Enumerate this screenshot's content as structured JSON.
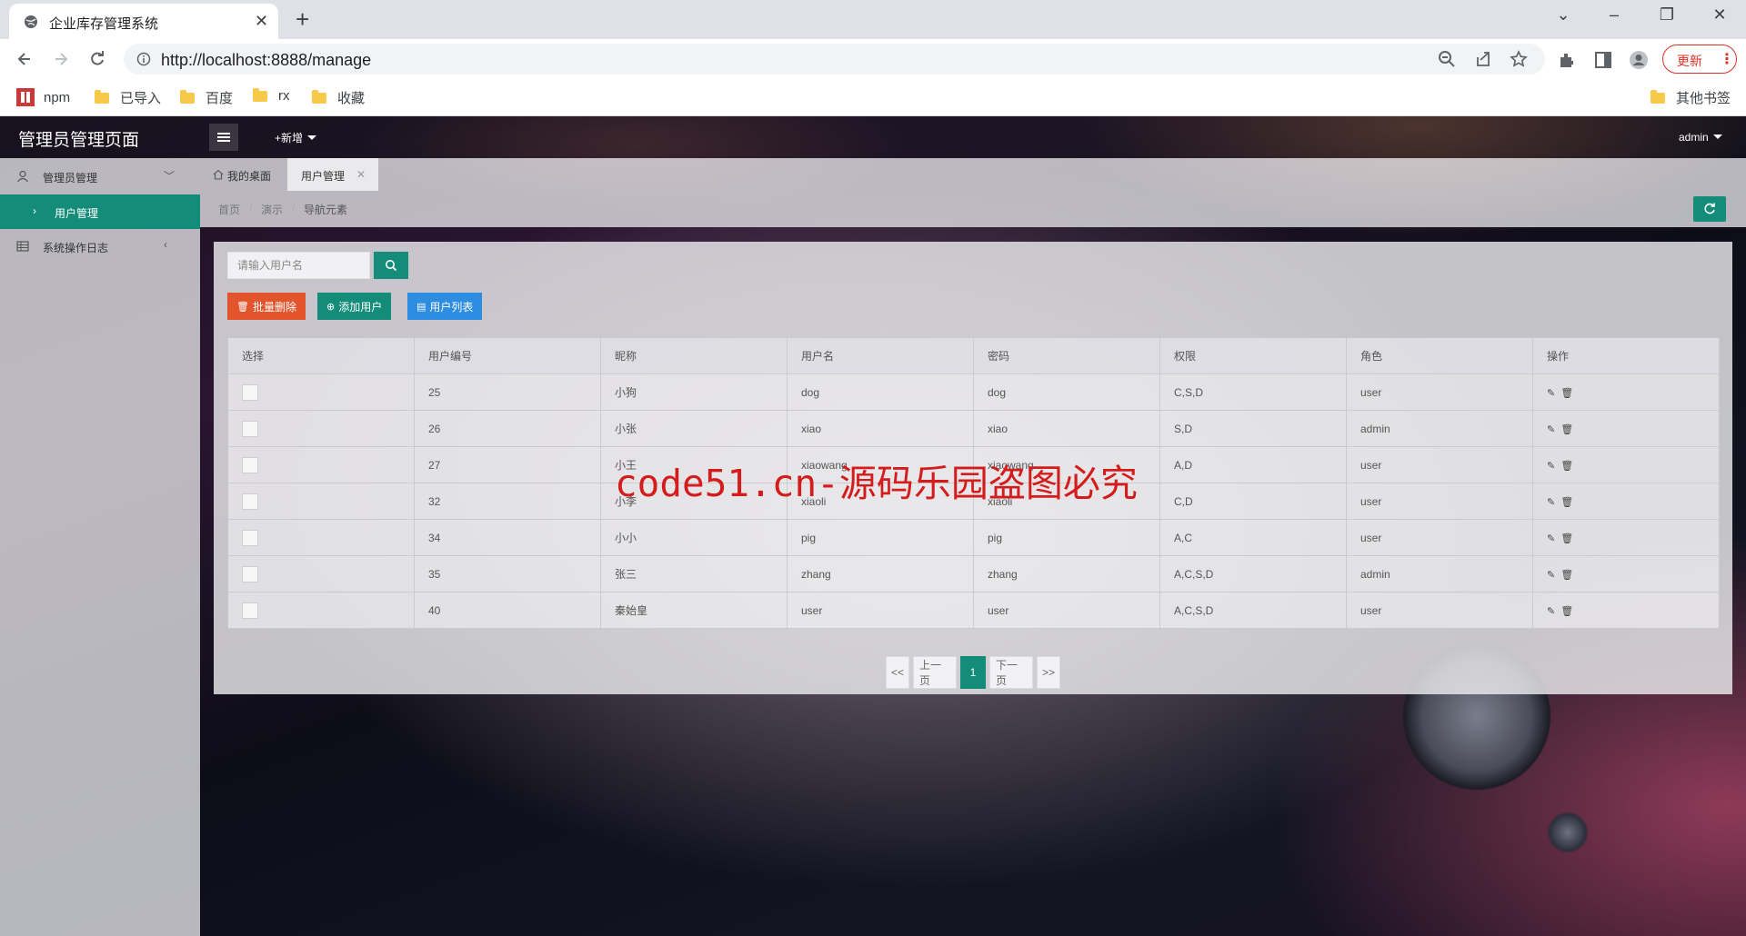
{
  "browser": {
    "tab_title": "企业库存管理系统",
    "url": "http://localhost:8888/manage",
    "update_label": "更新",
    "bookmarks": [
      "npm",
      "已导入",
      "百度",
      "rx",
      "收藏"
    ],
    "other_bookmarks": "其他书签"
  },
  "header": {
    "title": "管理员管理页面",
    "new_label": "+新增",
    "user_label": "admin"
  },
  "sidebar": {
    "items": [
      {
        "label": "管理员管理",
        "icon": "user-icon"
      },
      {
        "label": "用户管理",
        "icon": "chevron-right-icon"
      },
      {
        "label": "系统操作日志",
        "icon": "table-icon"
      }
    ]
  },
  "page_tabs": {
    "home": "我的桌面",
    "current": "用户管理"
  },
  "breadcrumb": [
    "首页",
    "演示",
    "导航元素"
  ],
  "search": {
    "placeholder": "请输入用户名"
  },
  "actions": {
    "batch_delete": "批量删除",
    "add_user": "添加用户",
    "user_list": "用户列表"
  },
  "table": {
    "headers": [
      "选择",
      "用户编号",
      "昵称",
      "用户名",
      "密码",
      "权限",
      "角色",
      "操作"
    ],
    "rows": [
      {
        "id": "25",
        "nickname": "小狗",
        "username": "dog",
        "password": "dog",
        "perm": "C,S,D",
        "role": "user"
      },
      {
        "id": "26",
        "nickname": "小张",
        "username": "xiao",
        "password": "xiao",
        "perm": "S,D",
        "role": "admin"
      },
      {
        "id": "27",
        "nickname": "小王",
        "username": "xiaowang",
        "password": "xiaowang",
        "perm": "A,D",
        "role": "user"
      },
      {
        "id": "32",
        "nickname": "小李",
        "username": "xiaoli",
        "password": "xiaoli",
        "perm": "C,D",
        "role": "user"
      },
      {
        "id": "34",
        "nickname": "小小",
        "username": "pig",
        "password": "pig",
        "perm": "A,C",
        "role": "user"
      },
      {
        "id": "35",
        "nickname": "张三",
        "username": "zhang",
        "password": "zhang",
        "perm": "A,C,S,D",
        "role": "admin"
      },
      {
        "id": "40",
        "nickname": "秦始皇",
        "username": "user",
        "password": "user",
        "perm": "A,C,S,D",
        "role": "user"
      }
    ]
  },
  "pager": {
    "first": "<<",
    "prev": "上一页",
    "current": "1",
    "next": "下一页",
    "last": ">>"
  },
  "watermark": "code51.cn-源码乐园盗图必究",
  "colors": {
    "primary": "#138d7a",
    "danger": "#e2552c",
    "info": "#2d8de0"
  }
}
